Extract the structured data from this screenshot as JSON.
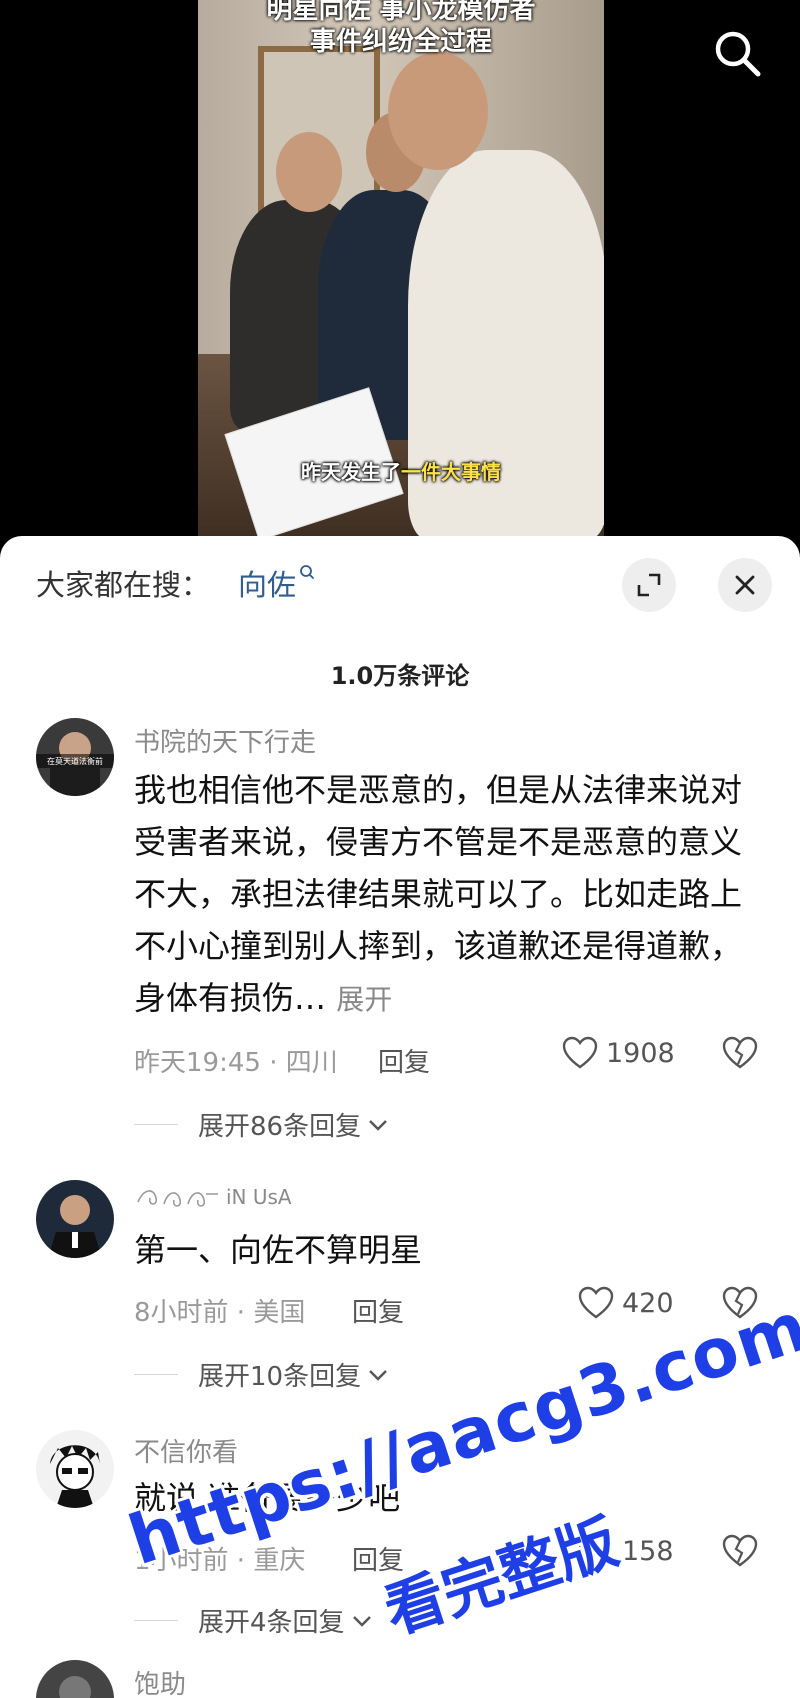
{
  "video": {
    "title_line1": "明星向佐 事小龙模仿者",
    "title_line2": "事件纠纷全过程",
    "caption_prefix": "昨天发生了",
    "caption_highlight": "一件大事情",
    "search_icon": "search-icon"
  },
  "sheet": {
    "trending_label": "大家都在搜：",
    "trending_term": "向佐",
    "expand_icon": "expand-icon",
    "close_icon": "close-icon",
    "comment_count": "1.0万条评论"
  },
  "comments": [
    {
      "username": "书院的天下行走",
      "avatar_caption": "在莫天道法衡前",
      "text": "我也相信他不是恶意的，但是从法律来说对受害者来说，侵害方不管是不是恶意的意义不大，承担法律结果就可以了。比如走路上不小心撞到别人摔到，该道歉还是得道歉，身体有损伤…",
      "expand_label": "展开",
      "time": "昨天19:45 · 四川",
      "reply_label": "回复",
      "likes": "1908",
      "replies_toggle": "展开86条回复"
    },
    {
      "username": "iN UsA",
      "text": "第一、向佐不算明星",
      "time": "8小时前 · 美国",
      "reply_label": "回复",
      "likes": "420",
      "replies_toggle": "展开10条回复"
    },
    {
      "username": "不信你看",
      "text": "就说 准备要多少吧",
      "time": "1小时前 · 重庆",
      "reply_label": "回复",
      "likes": "158",
      "replies_toggle": "展开4条回复"
    },
    {
      "username": "饱助"
    }
  ],
  "watermark": {
    "url": "https://aacg3.com",
    "text": "看完整版"
  },
  "colors": {
    "accent_link": "#2f5d8e",
    "watermark": "#1f3fe6",
    "caption_highlight": "#ffe14a"
  }
}
